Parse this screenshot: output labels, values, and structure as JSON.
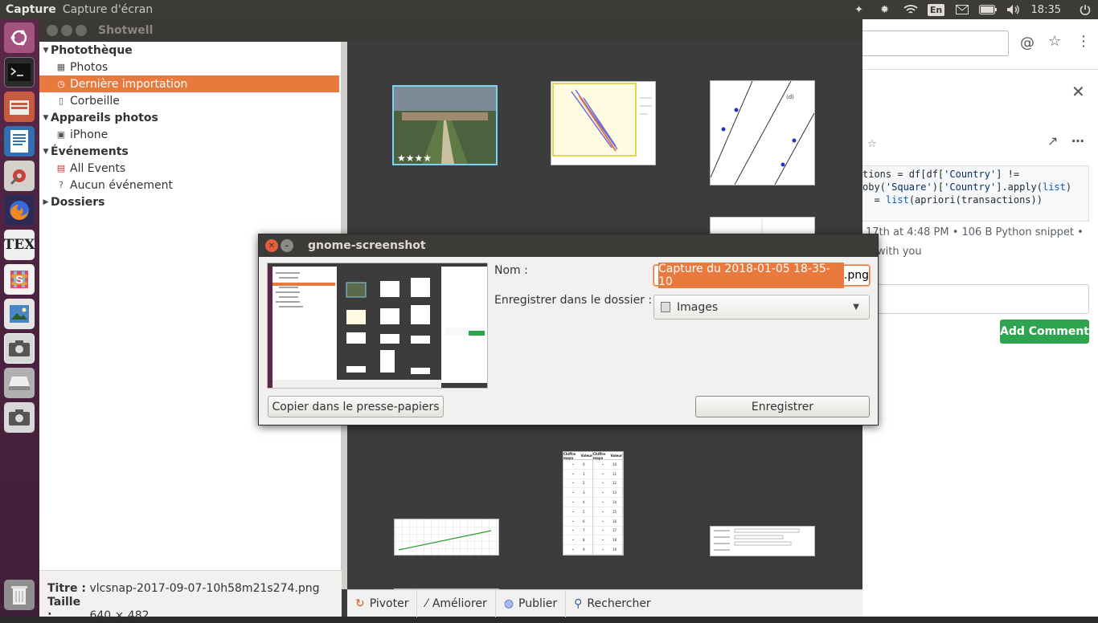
{
  "topbar": {
    "app_name": "Capture",
    "window_title": "Capture d'écran",
    "keyboard_layout": "En",
    "clock": "18:35"
  },
  "launcher": {
    "items": [
      "ubuntu-logo-icon",
      "terminal-icon",
      "file-manager-icon",
      "text-editor-icon",
      "system-settings-icon",
      "firefox-icon",
      "texmaker-icon",
      "slack-icon",
      "image-viewer-icon",
      "screenshot-icon",
      "drive-icon",
      "camera-icon",
      "trash-icon"
    ]
  },
  "shotwell": {
    "title": "Shotwell",
    "sidebar": {
      "library_header": "Photothèque",
      "photos": "Photos",
      "last_import": "Dernière importation",
      "trash": "Corbeille",
      "cameras_header": "Appareils photos",
      "iphone": "iPhone",
      "events_header": "Événements",
      "all_events": "All Events",
      "no_event": "Aucun événement",
      "folders_header": "Dossiers"
    },
    "info": {
      "title_label": "Titre :",
      "title_value": "vlcsnap-2017-09-07-10h58m21s274.png",
      "size_label": "Taille :",
      "size_value": "640 × 482"
    },
    "toolbar": {
      "rotate": "Pivoter",
      "enhance": "Améliorer",
      "publish": "Publier",
      "search": "Rechercher"
    },
    "table_thumb": {
      "col1": "Chiffre maya",
      "col2": "Valeur",
      "col3": "Chiffre maya",
      "col4": "Valeur",
      "left_values": [
        "0",
        "1",
        "2",
        "3",
        "4",
        "5",
        "6",
        "7",
        "8",
        "9"
      ],
      "right_values": [
        "10",
        "11",
        "12",
        "13",
        "14",
        "15",
        "16",
        "17",
        "18",
        "19"
      ]
    },
    "graph_thumb_label": "(d)"
  },
  "browser": {
    "code_lines": [
      [
        "tions = df[df[",
        "'Country'",
        "] !="
      ],
      [
        "oby(",
        "'Square'",
        ")[",
        "'Country'",
        "].apply(",
        "list",
        ")"
      ],
      [
        "  = ",
        "list",
        "(apriori(transactions))"
      ]
    ],
    "meta": "17th at 4:48 PM • 106 B Python snippet •",
    "meta2": "with you",
    "add_comment": "Add Comment"
  },
  "dialog": {
    "title": "gnome-screenshot",
    "name_label": "Nom :",
    "name_value_selected": "Capture du 2018-01-05 18-35-10",
    "name_value_ext": ".png",
    "folder_label": "Enregistrer dans le dossier :",
    "folder_value": "Images",
    "copy_button": "Copier dans le presse-papiers",
    "save_button": "Enregistrer"
  }
}
